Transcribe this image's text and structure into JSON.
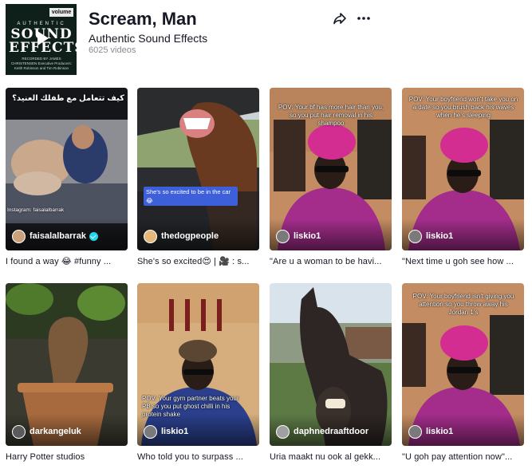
{
  "sound": {
    "title": "Scream, Man",
    "artist": "Authentic Sound Effects",
    "video_count": "6025 videos",
    "cover": {
      "volume_badge": "volume 4",
      "line1": "AUTHENTIC",
      "line2": "SOUND",
      "line3": "EFFECTS",
      "credits": "RECORDED BY JAMES CHRISTENSEN Executive Producers: Keith Robinson and Tim Robinson",
      "icon": "play-icon"
    },
    "actions": {
      "share_icon": "share-icon",
      "more_icon": "more-horizontal-icon"
    }
  },
  "videos": [
    {
      "creator": "faisalalbarrak",
      "verified": true,
      "caption": "I found a way 😂 #funny ...",
      "overlay_text": "كيف تتعامل مع طفلك العنيد؟",
      "watermark": "Instagram: faisalalbarrak",
      "avatar_color": "#c9a27a"
    },
    {
      "creator": "thedogpeople",
      "verified": false,
      "caption": "She's so excited😍 | 🎥 : s...",
      "overlay_text": "She's so excited to be in the car 😂",
      "avatar_color": "#e4b77a"
    },
    {
      "creator": "liskio1",
      "verified": false,
      "caption": "\"Are u a woman to be havi...",
      "overlay_text": "POV: Your bf has more hair than you, so you put hair removal in his shampoo",
      "avatar_color": "#7a7a7a"
    },
    {
      "creator": "liskio1",
      "verified": false,
      "caption": "\"Next time u goh see how ...",
      "overlay_text": "POV: Your boyfriend won't take you on a date so you brush back his waves when he's sleeping",
      "avatar_color": "#7a7a7a"
    },
    {
      "creator": "darkangeluk",
      "verified": false,
      "caption": "Harry Potter studios",
      "avatar_color": "#5a5a5a"
    },
    {
      "creator": "liskio1",
      "verified": false,
      "caption": "Who told you to surpass ...",
      "overlay_text": "POV: Your gym partner beats your PB so you put ghost chilli in his protein shake",
      "avatar_color": "#7a7a7a"
    },
    {
      "creator": "daphnedraaftdoor",
      "verified": false,
      "caption": "Uria maakt nu ook al gekk...",
      "avatar_color": "#a0a0a0"
    },
    {
      "creator": "liskio1",
      "verified": false,
      "caption": "\"U goh pay attention now\"...",
      "overlay_text": "POV: Your boyfriend isn't giving you attention so you throw away his Jordan 1's",
      "avatar_color": "#7a7a7a"
    }
  ]
}
